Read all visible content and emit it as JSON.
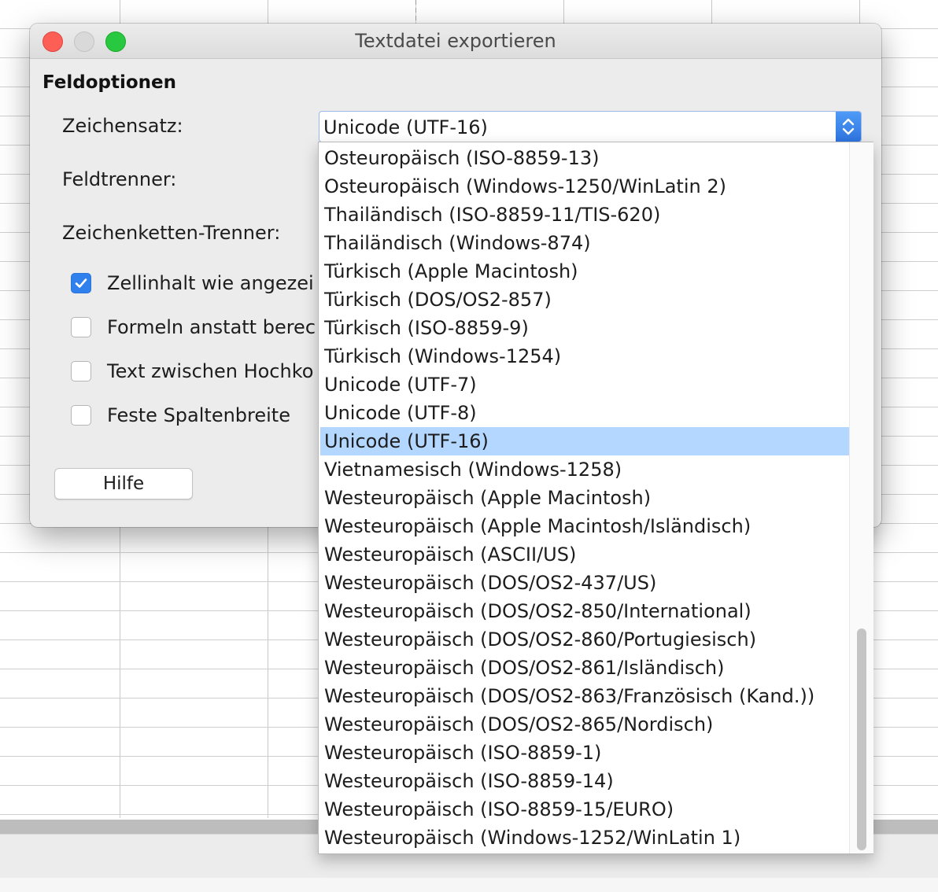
{
  "dialog": {
    "title": "Textdatei exportieren",
    "section_title": "Feldoptionen",
    "labels": {
      "charset": "Zeichensatz:",
      "field_sep": "Feldtrenner:",
      "string_sep": "Zeichenketten-Trenner:"
    },
    "checkboxes": [
      {
        "label": "Zellinhalt wie angezei",
        "checked": true
      },
      {
        "label": "Formeln anstatt berec",
        "checked": false
      },
      {
        "label": "Text zwischen Hochko",
        "checked": false
      },
      {
        "label": "Feste Spaltenbreite",
        "checked": false
      }
    ],
    "help_button": "Hilfe"
  },
  "charset_select": {
    "value": "Unicode (UTF-16)",
    "options": [
      "Osteuropäisch (ISO-8859-13)",
      "Osteuropäisch (Windows-1250/WinLatin 2)",
      "Thailändisch (ISO-8859-11/TIS-620)",
      "Thailändisch (Windows-874)",
      "Türkisch (Apple Macintosh)",
      "Türkisch (DOS/OS2-857)",
      "Türkisch (ISO-8859-9)",
      "Türkisch (Windows-1254)",
      "Unicode (UTF-7)",
      "Unicode (UTF-8)",
      "Unicode (UTF-16)",
      "Vietnamesisch (Windows-1258)",
      "Westeuropäisch (Apple Macintosh)",
      "Westeuropäisch (Apple Macintosh/Isländisch)",
      "Westeuropäisch (ASCII/US)",
      "Westeuropäisch (DOS/OS2-437/US)",
      "Westeuropäisch (DOS/OS2-850/International)",
      "Westeuropäisch (DOS/OS2-860/Portugiesisch)",
      "Westeuropäisch (DOS/OS2-861/Isländisch)",
      "Westeuropäisch (DOS/OS2-863/Französisch (Kand.))",
      "Westeuropäisch (DOS/OS2-865/Nordisch)",
      "Westeuropäisch (ISO-8859-1)",
      "Westeuropäisch (ISO-8859-14)",
      "Westeuropäisch (ISO-8859-15/EURO)",
      "Westeuropäisch (Windows-1252/WinLatin 1)"
    ],
    "selected_index": 10
  },
  "colors": {
    "accent": "#2f80ed",
    "selection": "#b3d7ff",
    "close": "#fd5f57",
    "zoom": "#28c840"
  }
}
